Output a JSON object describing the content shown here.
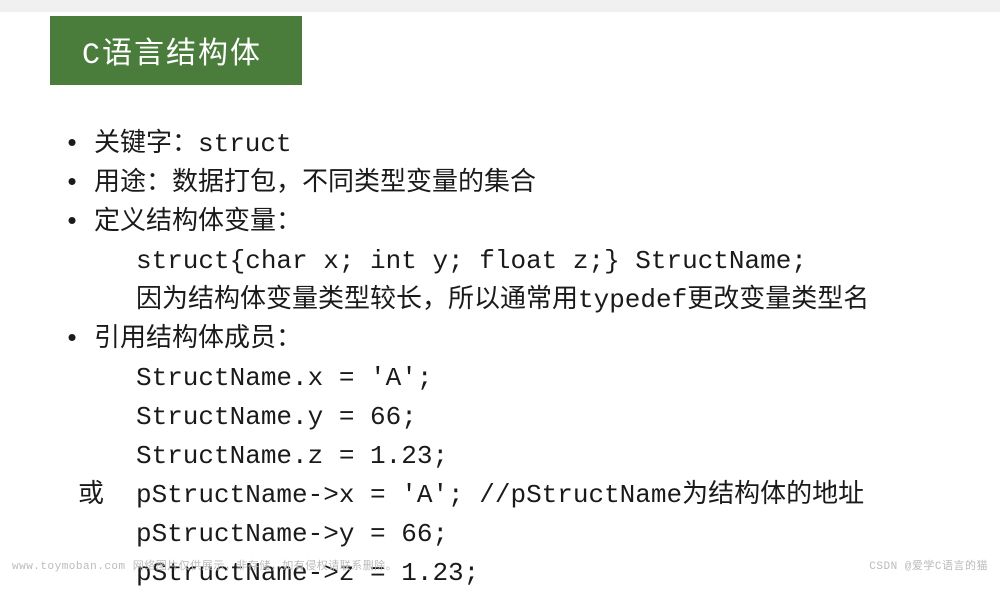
{
  "header": {
    "title": "C语言结构体"
  },
  "bullets": {
    "b1": "关键字：struct",
    "b2": "用途：数据打包，不同类型变量的集合",
    "b3": "定义结构体变量：",
    "b3_code": "struct{char x; int y; float z;} StructName;",
    "b3_note": "因为结构体变量类型较长，所以通常用typedef更改变量类型名",
    "b4": "引用结构体成员：",
    "code1": "StructName.x = 'A';",
    "code2": "StructName.y = 66;",
    "code3": "StructName.z = 1.23;",
    "or_label": "或",
    "code4": "pStructName->x = 'A';   //pStructName为结构体的地址",
    "code5": "pStructName->y = 66;",
    "code6": "pStructName->z = 1.23;"
  },
  "footer": {
    "left": "www.toymoban.com 网络图片仅供展示，非存储，如有侵权请联系删除。",
    "right": "CSDN @爱学C语言的猫"
  }
}
